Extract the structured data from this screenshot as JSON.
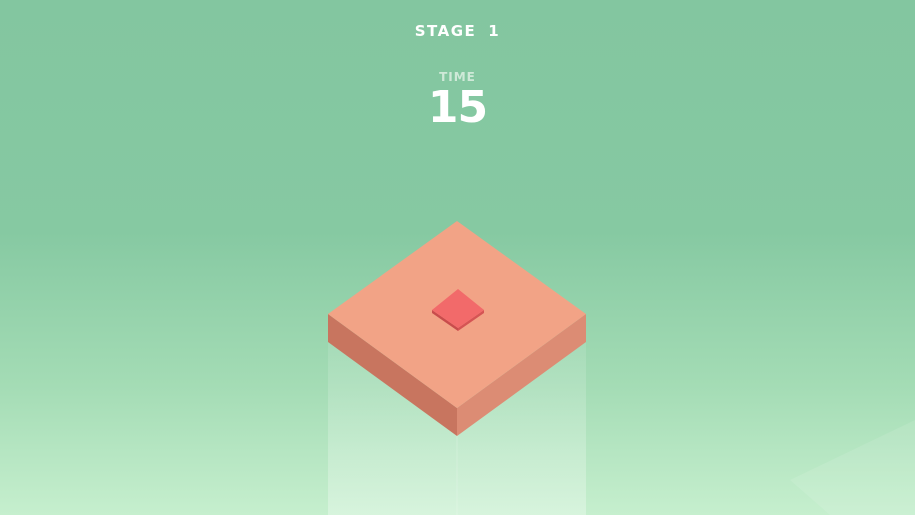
{
  "hud": {
    "stage_label": "STAGE",
    "stage_number": "1",
    "time_label": "TIME",
    "time_value": "15"
  },
  "colors": {
    "background_top": "#83c6a0",
    "background_bottom": "#c6efce",
    "platform_top": "#f2a386",
    "platform_left": "#c8755f",
    "platform_right": "#dc8c74",
    "player_top": "#f26a6a",
    "player_side": "#d55454",
    "text": "#ffffff"
  },
  "scene": {
    "platform_icon": "square-tile-icon",
    "player_icon": "red-cube-icon"
  }
}
